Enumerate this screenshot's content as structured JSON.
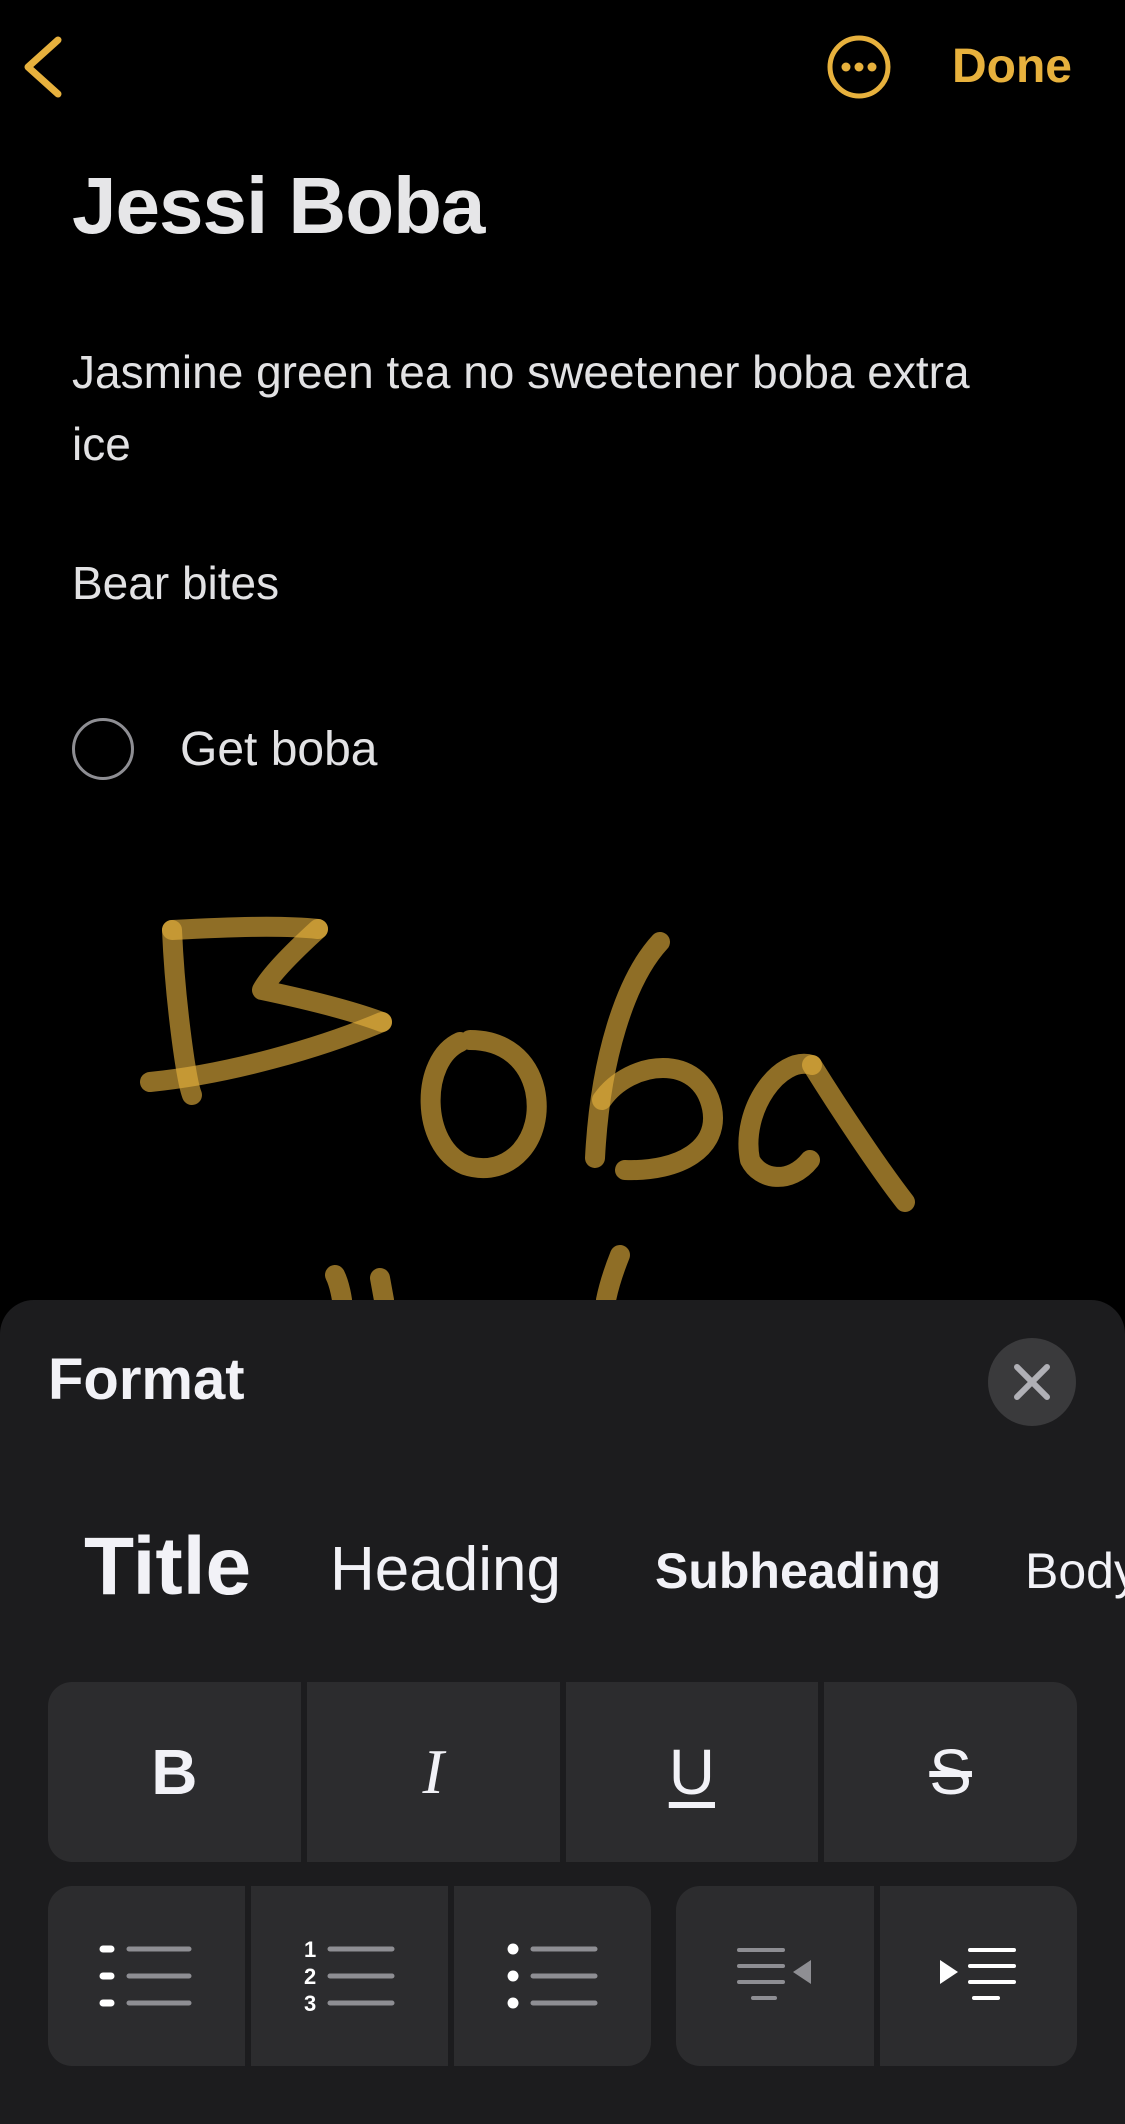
{
  "nav": {
    "done_label": "Done",
    "accent_color": "#E7B13D",
    "back_icon": "chevron-left-icon",
    "more_icon": "ellipsis-circle-icon"
  },
  "note": {
    "title": "Jessi Boba",
    "body": "Jasmine green tea no sweetener boba extra ice",
    "subtext": "Bear bites",
    "checklist": [
      {
        "label": "Get boba",
        "checked": false
      }
    ],
    "drawing": {
      "text": "Boba",
      "color": "#E7B13D"
    }
  },
  "format_panel": {
    "title": "Format",
    "close_icon": "close-icon",
    "styles": [
      "Title",
      "Heading",
      "Subheading",
      "Body"
    ],
    "text_styles": {
      "bold": "B",
      "italic": "I",
      "underline": "U",
      "strikethrough": "S"
    },
    "list_buttons": [
      "dashed-list-icon",
      "numbered-list-icon",
      "bulleted-list-icon"
    ],
    "indent_buttons": [
      "outdent-icon",
      "indent-icon"
    ],
    "numbers": [
      "1",
      "2",
      "3"
    ]
  }
}
